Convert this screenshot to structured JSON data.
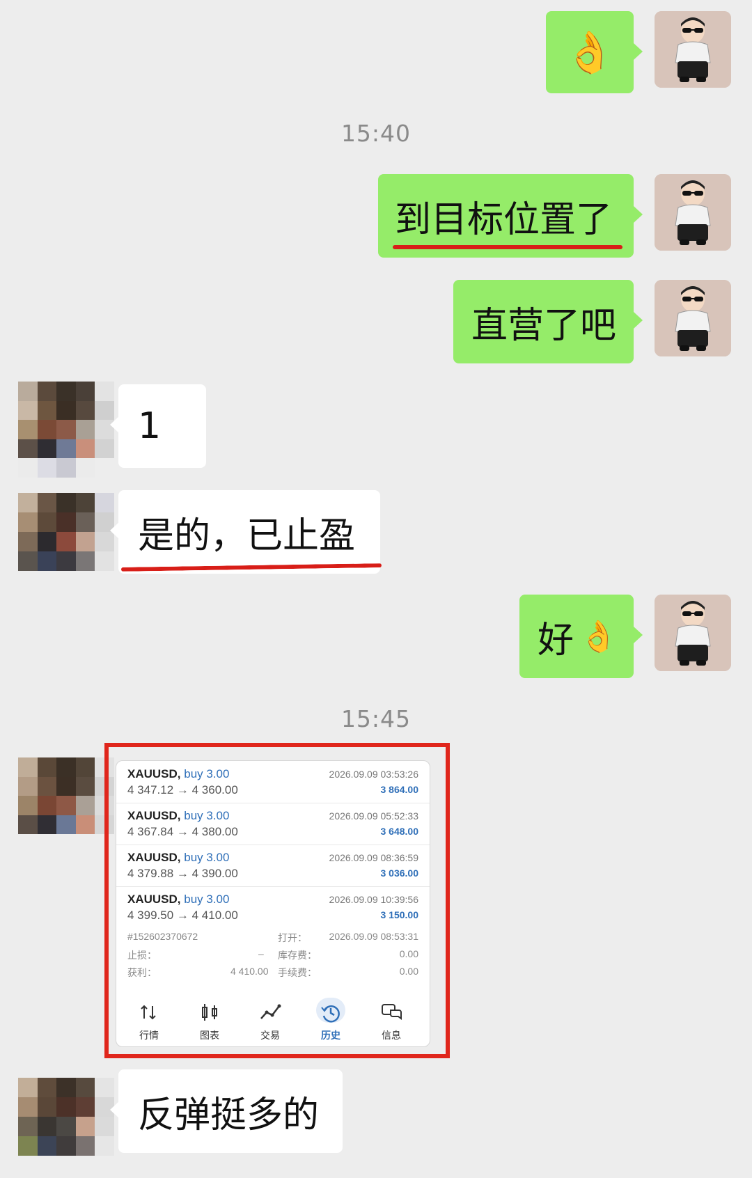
{
  "messages": {
    "m1_emoji": "👌",
    "time1": "15:40",
    "m2": "到目标位置了",
    "m3": "直营了吧",
    "m4": "1",
    "m5": "是的，已止盈",
    "m6_text": "好",
    "m6_emoji": "👌",
    "time2": "15:45",
    "m8": "反弹挺多的"
  },
  "trade_screenshot": {
    "trades": [
      {
        "symbol": "XAUUSD,",
        "direction": "buy 3.00",
        "price": "4 347.12 → 4 360.00",
        "date": "2026.09.09 03:53:26",
        "profit": "3 864.00"
      },
      {
        "symbol": "XAUUSD,",
        "direction": "buy 3.00",
        "price": "4 367.84 → 4 380.00",
        "date": "2026.09.09 05:52:33",
        "profit": "3 648.00"
      },
      {
        "symbol": "XAUUSD,",
        "direction": "buy 3.00",
        "price": "4 379.88 → 4 390.00",
        "date": "2026.09.09 08:36:59",
        "profit": "3 036.00"
      },
      {
        "symbol": "XAUUSD,",
        "direction": "buy 3.00",
        "price": "4 399.50 → 4 410.00",
        "date": "2026.09.09 10:39:56",
        "profit": "3 150.00"
      }
    ],
    "details": {
      "order_id": "#152602370672",
      "open_label": "打开：",
      "open_time": "2026.09.09 08:53:31",
      "sl_label": "止损：",
      "sl_value": "–",
      "swap_label": "库存费：",
      "swap_value": "0.00",
      "profit_label": "获利：",
      "profit_value": "4 410.00",
      "fee_label": "手续费：",
      "fee_value": "0.00"
    },
    "nav": [
      {
        "label": "行情",
        "icon": "quotes-icon"
      },
      {
        "label": "图表",
        "icon": "chart-icon"
      },
      {
        "label": "交易",
        "icon": "trade-icon"
      },
      {
        "label": "历史",
        "icon": "history-icon"
      },
      {
        "label": "信息",
        "icon": "messages-icon"
      }
    ],
    "nav_active": "历史"
  },
  "colors": {
    "background": "#ededed",
    "self_bubble": "#95ec69",
    "other_bubble": "#ffffff",
    "highlight_red": "#d81e18",
    "link_blue": "#2f6fb8"
  }
}
